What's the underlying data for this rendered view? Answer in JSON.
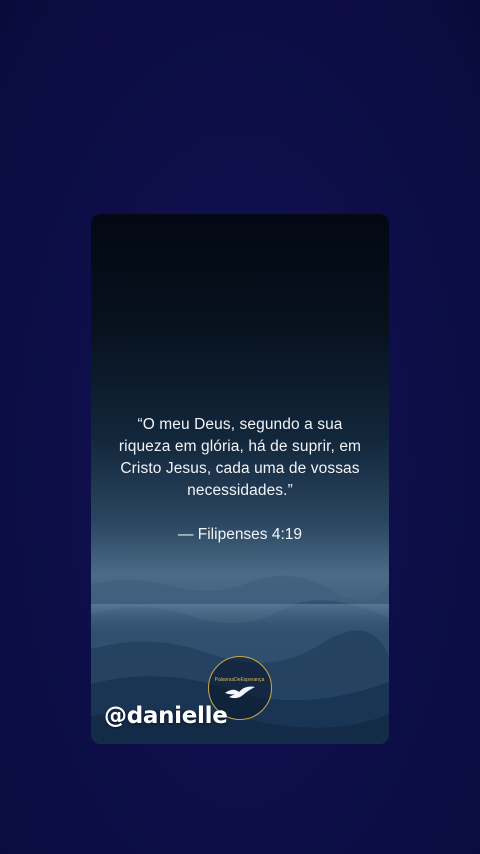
{
  "post": {
    "quote": "“O meu Deus, segundo a sua riqueza em glória, há de suprir, em Cristo Jesus, cada uma de vossas necessidades.”",
    "reference": "— Filipenses 4:19",
    "logo_text": "PalavrasDeEsperança",
    "logo_icon": "dove-icon"
  },
  "overlay": {
    "username": "@danielle"
  },
  "colors": {
    "background": "#0c0c40",
    "text": "#f2f4f8",
    "logo_accent": "#c9a64e"
  }
}
